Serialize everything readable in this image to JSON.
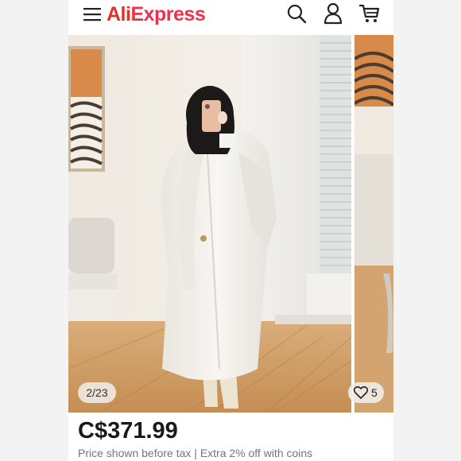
{
  "header": {
    "logo_part1": "Ali",
    "logo_part2": "Express",
    "icons": [
      "menu-icon",
      "search-icon",
      "user-icon",
      "cart-icon"
    ]
  },
  "gallery": {
    "counter": "2/23",
    "wishlist_count": "5"
  },
  "product": {
    "price": "C$371.99",
    "price_note": "Price shown before tax | Extra 2% off with coins"
  },
  "colors": {
    "brand_red": "#e43225",
    "brand_pink": "#f0304d",
    "text_dark": "#191919",
    "text_muted": "#757575"
  }
}
